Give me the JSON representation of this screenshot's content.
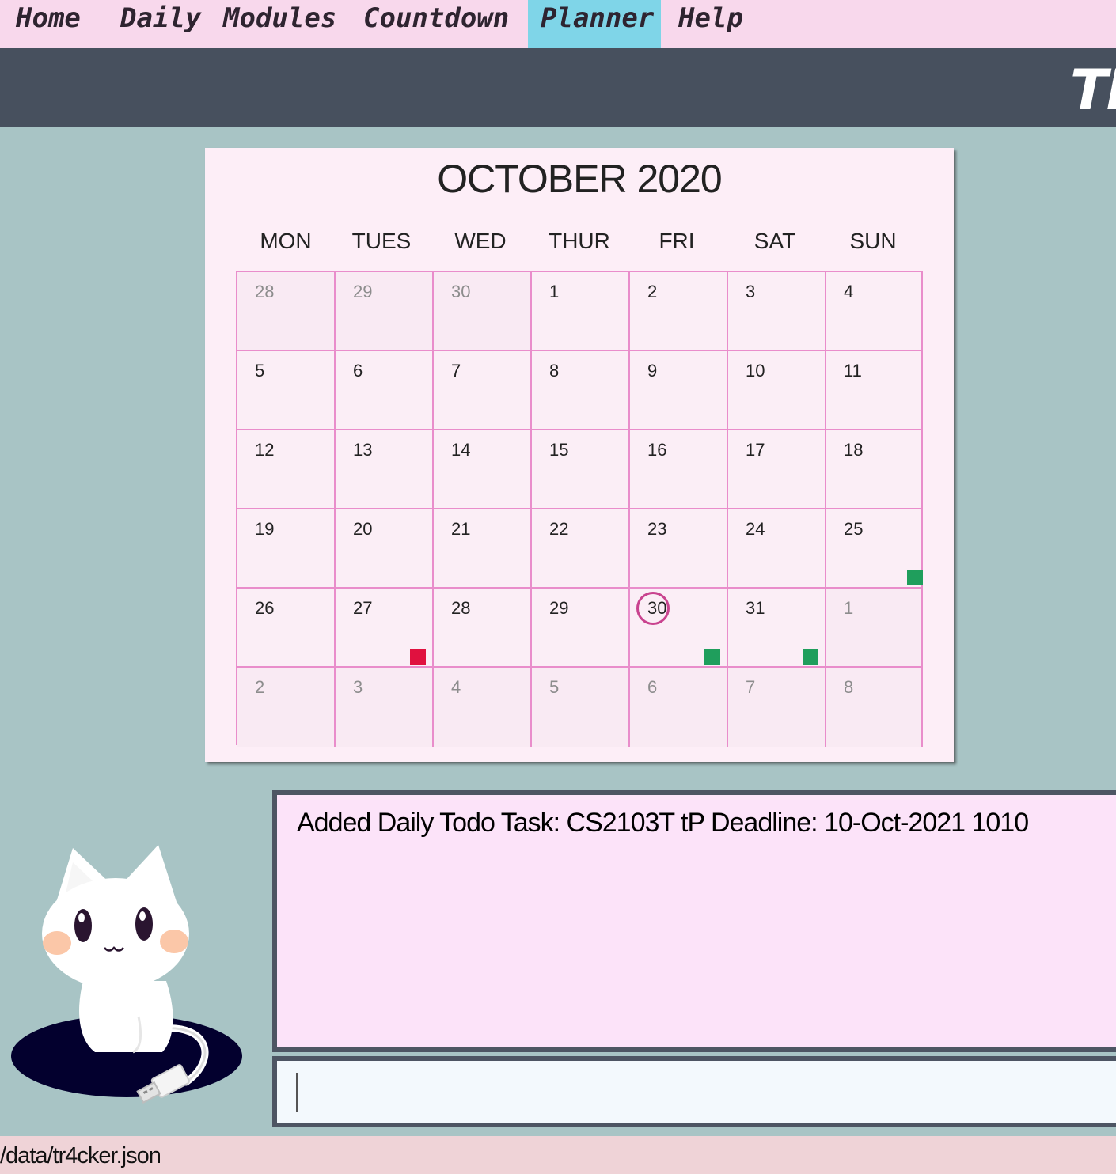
{
  "menu": {
    "items": [
      "Home",
      "Daily",
      "Modules",
      "Countdown",
      "Planner",
      "Help"
    ],
    "active": "Planner"
  },
  "header": {
    "title": "TR"
  },
  "calendar": {
    "title": "OCTOBER 2020",
    "weekdays": [
      "MON",
      "TUES",
      "WED",
      "THUR",
      "FRI",
      "SAT",
      "SUN"
    ],
    "weeks": [
      [
        {
          "d": "28",
          "other": true
        },
        {
          "d": "29",
          "other": true
        },
        {
          "d": "30",
          "other": true
        },
        {
          "d": "1"
        },
        {
          "d": "2"
        },
        {
          "d": "3"
        },
        {
          "d": "4"
        }
      ],
      [
        {
          "d": "5"
        },
        {
          "d": "6"
        },
        {
          "d": "7"
        },
        {
          "d": "8"
        },
        {
          "d": "9"
        },
        {
          "d": "10"
        },
        {
          "d": "11"
        }
      ],
      [
        {
          "d": "12"
        },
        {
          "d": "13"
        },
        {
          "d": "14"
        },
        {
          "d": "15"
        },
        {
          "d": "16"
        },
        {
          "d": "17"
        },
        {
          "d": "18"
        }
      ],
      [
        {
          "d": "19"
        },
        {
          "d": "20"
        },
        {
          "d": "21"
        },
        {
          "d": "22"
        },
        {
          "d": "23"
        },
        {
          "d": "24"
        },
        {
          "d": "25",
          "marker": "#1f9e5c"
        }
      ],
      [
        {
          "d": "26"
        },
        {
          "d": "27",
          "marker": "#e0113f"
        },
        {
          "d": "28"
        },
        {
          "d": "29"
        },
        {
          "d": "30",
          "today": true,
          "marker": "#1f9e5c"
        },
        {
          "d": "31",
          "marker": "#1f9e5c"
        },
        {
          "d": "1",
          "other": true
        }
      ],
      [
        {
          "d": "2",
          "other": true
        },
        {
          "d": "3",
          "other": true
        },
        {
          "d": "4",
          "other": true
        },
        {
          "d": "5",
          "other": true
        },
        {
          "d": "6",
          "other": true
        },
        {
          "d": "7",
          "other": true
        },
        {
          "d": "8",
          "other": true
        }
      ]
    ],
    "colors": {
      "grid_line": "#e98dcb",
      "today_ring": "#c9438f",
      "task_due": "#1f9e5c",
      "task_overdue": "#e0113f"
    }
  },
  "result": {
    "text": "Added Daily Todo Task: CS2103T tP Deadline: 10-Oct-2021 1010"
  },
  "command": {
    "value": ""
  },
  "status": {
    "path": "/data/tr4cker.json"
  }
}
